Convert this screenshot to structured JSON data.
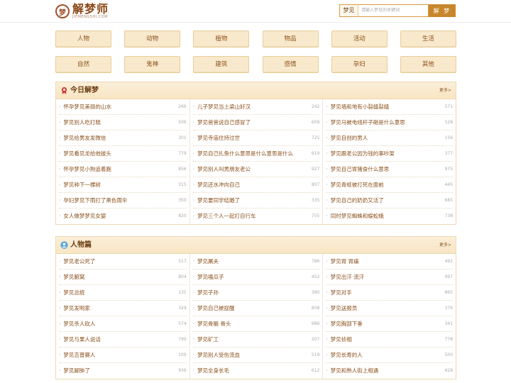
{
  "header": {
    "logo_mark": "梦",
    "logo_title": "解梦师",
    "logo_sub": "JIEMENGSHI.COM",
    "search_label": "梦见",
    "search_placeholder": "请输入梦见的关键词",
    "search_button": "解 梦"
  },
  "categories": [
    [
      "人物",
      "动物",
      "植物",
      "物品",
      "活动",
      "生活"
    ],
    [
      "自然",
      "鬼神",
      "建筑",
      "感情",
      "孕妇",
      "其他"
    ]
  ],
  "today": {
    "title": "今日解梦",
    "more": "更多>",
    "columns": [
      [
        {
          "title": "怀孕梦见美丽的山水",
          "count": "266"
        },
        {
          "title": "梦见别人吃打糕",
          "count": "506"
        },
        {
          "title": "梦见给男友发微信",
          "count": "301"
        },
        {
          "title": "梦见看见龙给他拔头",
          "count": "779"
        },
        {
          "title": "怀孕梦见小狗追着跑",
          "count": "856"
        },
        {
          "title": "梦见种下一棵树",
          "count": "315"
        },
        {
          "title": "孕妇梦见下雨打了黑色雨伞",
          "count": "350"
        },
        {
          "title": "女人做梦梦见女婴",
          "count": "820"
        }
      ],
      [
        {
          "title": "儿子梦见当上梁山好汉",
          "count": "242"
        },
        {
          "title": "梦见爸爸说自己感冒了",
          "count": "609"
        },
        {
          "title": "梦见寺庙住持过世",
          "count": "725"
        },
        {
          "title": "梦见自己扎鱼什么意思是什么意思是什么",
          "count": "919"
        },
        {
          "title": "梦见别人叫男朋友老公",
          "count": "927"
        },
        {
          "title": "梦见还水冲向自己",
          "count": "807"
        },
        {
          "title": "梦见要同学结婚了",
          "count": "335"
        },
        {
          "title": "梦见三个人一起打自行车",
          "count": "755"
        }
      ],
      [
        {
          "title": "梦见墙和地有小裂缝裂缝",
          "count": "571"
        },
        {
          "title": "梦见马被电线杆子砸是什么意思",
          "count": "528"
        },
        {
          "title": "梦见自创的男人",
          "count": "156"
        },
        {
          "title": "梦见跟老公因为钱的事吵架",
          "count": "377"
        },
        {
          "title": "梦见自己胃猪食什么意思",
          "count": "975"
        },
        {
          "title": "梦见青蛙被打死在面前",
          "count": "445"
        },
        {
          "title": "梦见自己的奶奶又活了",
          "count": "685"
        },
        {
          "title": "同时梦见蜘蛛和蜈蚣蛾",
          "count": "738"
        }
      ]
    ]
  },
  "people": {
    "title": "人物篇",
    "more": "更多>",
    "columns": [
      [
        {
          "title": "梦见老公死了",
          "count": "517"
        },
        {
          "title": "梦见腑窝",
          "count": "804"
        },
        {
          "title": "梦见总统",
          "count": "135"
        },
        {
          "title": "梦见发明家",
          "count": "329"
        },
        {
          "title": "梦见杀人砍人",
          "count": "574"
        },
        {
          "title": "梦见与果人说话",
          "count": "799"
        },
        {
          "title": "梦见吉普赛人",
          "count": "109"
        },
        {
          "title": "梦见脚肿了",
          "count": "936"
        }
      ],
      [
        {
          "title": "梦见屠夫",
          "count": "786"
        },
        {
          "title": "梦见嗑瓜子",
          "count": "452"
        },
        {
          "title": "梦见子孙",
          "count": "380"
        },
        {
          "title": "梦见自己被捉醒",
          "count": "858"
        },
        {
          "title": "梦见骨骼 骨头",
          "count": "986"
        },
        {
          "title": "梦见矿工",
          "count": "207"
        },
        {
          "title": "梦见别人受伤流血",
          "count": "519"
        },
        {
          "title": "梦见全身长毛",
          "count": "612"
        }
      ],
      [
        {
          "title": "梦见胃 胃痛",
          "count": "492"
        },
        {
          "title": "梦见出汗 流汗",
          "count": "997"
        },
        {
          "title": "梦见对手",
          "count": "865"
        },
        {
          "title": "梦见送报员",
          "count": "376"
        },
        {
          "title": "梦见胸部下垂",
          "count": "341"
        },
        {
          "title": "梦见侦相",
          "count": "778"
        },
        {
          "title": "梦见长寿的人",
          "count": "500"
        },
        {
          "title": "梦见和熟人街上相遇",
          "count": "628"
        }
      ]
    ]
  },
  "colors": {
    "accent": "#c8872c",
    "category_bg": "#f9e9cc",
    "link_text": "#8a4f1a"
  }
}
